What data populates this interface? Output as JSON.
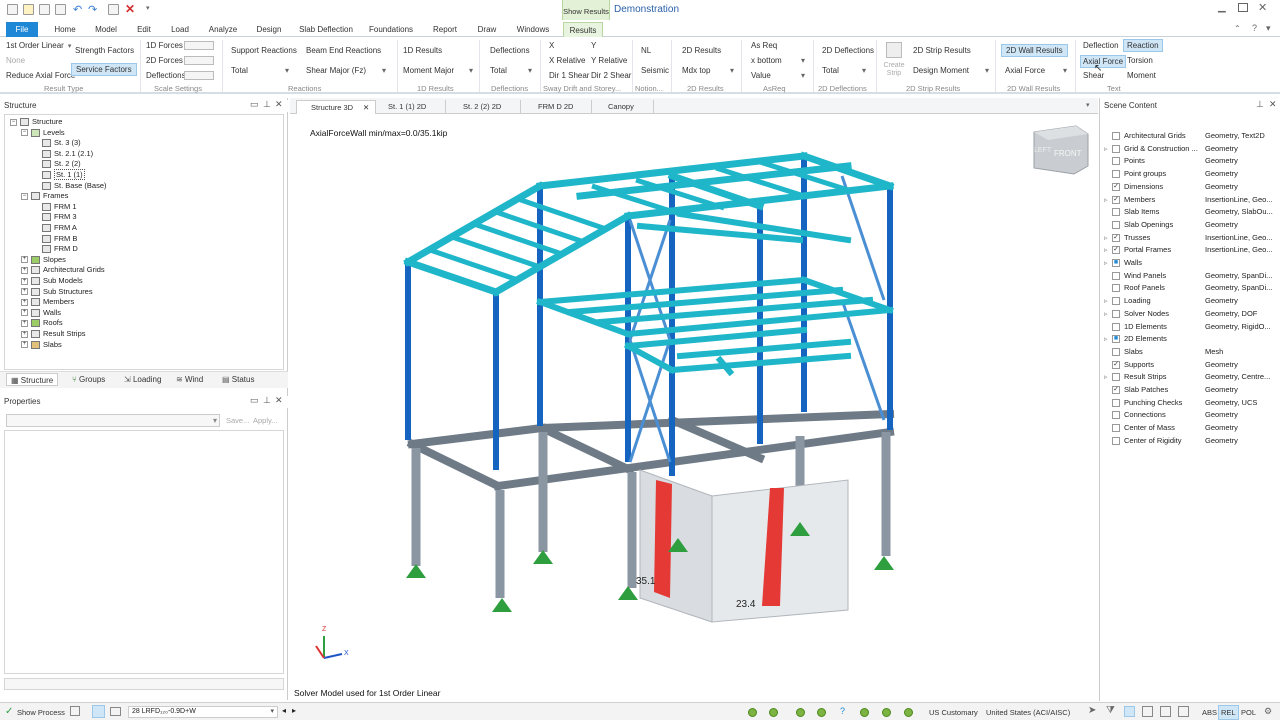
{
  "titlebar": {
    "show_results": "Show Results",
    "title": "Demonstration"
  },
  "tabs": [
    "File",
    "Home",
    "Model",
    "Edit",
    "Load",
    "Analyze",
    "Design",
    "Slab Deflection",
    "Foundations",
    "Report",
    "Draw",
    "Windows",
    "Results"
  ],
  "ribbon": {
    "analysis_type": "1st Order Linear",
    "none": "None",
    "reduce_axial": "Reduce Axial Force",
    "strength_factors": "Strength Factors",
    "service_factors": "Service Factors",
    "forces_1d": "1D Forces",
    "forces_2d": "2D Forces",
    "deflections": "Deflections",
    "support_reactions": "Support Reactions",
    "total": "Total",
    "beam_end_reactions": "Beam End Reactions",
    "shear_major": "Shear Major (Fz)",
    "results_1d": "1D Results",
    "moment_major": "Moment Major",
    "deflections2": "Deflections",
    "total2": "Total",
    "x": "X",
    "y": "Y",
    "x_relative": "X Relative",
    "y_relative": "Y Relative",
    "dir1_shear": "Dir 1 Shear",
    "dir2_shear": "Dir 2 Shear",
    "nl": "NL",
    "seismic": "Seismic",
    "results_2d": "2D Results",
    "mdx_top": "Mdx top",
    "as_req": "As Req",
    "x_bottom": "x bottom",
    "value": "Value",
    "deflections_2d": "2D Deflections",
    "total3": "Total",
    "create_strip": "Create Strip",
    "strip_results": "2D Strip Results",
    "design_moment": "Design Moment",
    "wall_results": "2D Wall Results",
    "axial_force": "Axial Force",
    "deflection": "Deflection",
    "reaction": "Reaction",
    "axial_force2": "Axial Force",
    "torsion": "Torsion",
    "shear": "Shear",
    "moment": "Moment",
    "groups": [
      "Result Type",
      "Scale Settings",
      "Reactions",
      "1D Results",
      "Deflections",
      "Sway Drift and Storey...",
      "Notion...",
      "2D Results",
      "AsReq",
      "2D Deflections",
      "2D Strip Results",
      "2D Wall Results",
      "Text"
    ]
  },
  "structure_panel": {
    "title": "Structure",
    "nodes": [
      "Structure",
      "Levels",
      "St. 3 (3)",
      "St. 2.1 (2.1)",
      "St. 2 (2)",
      "St. 1 (1)",
      "St. Base (Base)",
      "Frames",
      "FRM 1",
      "FRM 3",
      "FRM A",
      "FRM B",
      "FRM D",
      "Slopes",
      "Architectural Grids",
      "Sub Models",
      "Sub Structures",
      "Members",
      "Walls",
      "Roofs",
      "Result Strips",
      "Slabs"
    ],
    "bottom_tabs": [
      "Structure",
      "Groups",
      "Loading",
      "Wind",
      "Status"
    ]
  },
  "properties_panel": {
    "title": "Properties",
    "save": "Save...",
    "apply": "Apply..."
  },
  "view_tabs": [
    "Structure 3D",
    "St. 1 (1) 2D",
    "St. 2 (2) 2D",
    "FRM D 2D",
    "Canopy"
  ],
  "viewport": {
    "header": "AxialForceWall min/max=0.0/35.1kip",
    "label1": "35.1",
    "label2": "23.4",
    "footer": "Solver Model used for 1st Order Linear",
    "cube_front": "FRONT",
    "cube_left": "LEFT",
    "axis_x": "X",
    "axis_z": "Z"
  },
  "scene_content": {
    "title": "Scene Content",
    "rows": [
      {
        "name": "Architectural Grids",
        "value": "Geometry, Text2D",
        "checked": false,
        "exp": false
      },
      {
        "name": "Grid & Construction ...",
        "value": "Geometry",
        "checked": false,
        "exp": true
      },
      {
        "name": "Points",
        "value": "Geometry",
        "checked": false,
        "exp": false
      },
      {
        "name": "Point groups",
        "value": "Geometry",
        "checked": false,
        "exp": false
      },
      {
        "name": "Dimensions",
        "value": "Geometry",
        "checked": true,
        "exp": false
      },
      {
        "name": "Members",
        "value": "InsertionLine, Geo...",
        "checked": true,
        "exp": true
      },
      {
        "name": "Slab Items",
        "value": "Geometry, SlabOu...",
        "checked": false,
        "exp": false
      },
      {
        "name": "Slab Openings",
        "value": "Geometry",
        "checked": false,
        "exp": false
      },
      {
        "name": "Trusses",
        "value": "InsertionLine, Geo...",
        "checked": true,
        "exp": true
      },
      {
        "name": "Portal Frames",
        "value": "InsertionLine, Geo...",
        "checked": true,
        "exp": true
      },
      {
        "name": "Walls",
        "value": "",
        "checked": true,
        "exp": true
      },
      {
        "name": "Wind Panels",
        "value": "Geometry, SpanDi...",
        "checked": false,
        "exp": false
      },
      {
        "name": "Roof Panels",
        "value": "Geometry, SpanDi...",
        "checked": false,
        "exp": false
      },
      {
        "name": "Loading",
        "value": "Geometry",
        "checked": false,
        "exp": true
      },
      {
        "name": "Solver Nodes",
        "value": "Geometry, DOF",
        "checked": false,
        "exp": true
      },
      {
        "name": "1D Elements",
        "value": "Geometry, RigidO...",
        "checked": false,
        "exp": false
      },
      {
        "name": "2D Elements",
        "value": "",
        "checked": true,
        "exp": true
      },
      {
        "name": "Slabs",
        "value": "Mesh",
        "checked": false,
        "exp": false
      },
      {
        "name": "Supports",
        "value": "Geometry",
        "checked": true,
        "exp": false
      },
      {
        "name": "Result Strips",
        "value": "Geometry, Centre...",
        "checked": false,
        "exp": true
      },
      {
        "name": "Slab Patches",
        "value": "Geometry",
        "checked": true,
        "exp": false
      },
      {
        "name": "Punching Checks",
        "value": "Geometry, UCS",
        "checked": false,
        "exp": false
      },
      {
        "name": "Connections",
        "value": "Geometry",
        "checked": false,
        "exp": false
      },
      {
        "name": "Center of Mass",
        "value": "Geometry",
        "checked": false,
        "exp": false
      },
      {
        "name": "Center of Rigidity",
        "value": "Geometry",
        "checked": false,
        "exp": false
      }
    ]
  },
  "statusbar": {
    "show_process": "Show Process",
    "combo": "28 LRFD₁₂₀-0.9D+W",
    "units": "US Customary",
    "code": "United States (ACI/AISC)",
    "abs": "ABS",
    "rel": "REL",
    "pol": "POL"
  },
  "colors": {
    "accent": "#1e88d6",
    "beam": "#1fb6c9",
    "column": "#1565c0",
    "wall_result": "#e53935",
    "support": "#2e9e3e"
  }
}
